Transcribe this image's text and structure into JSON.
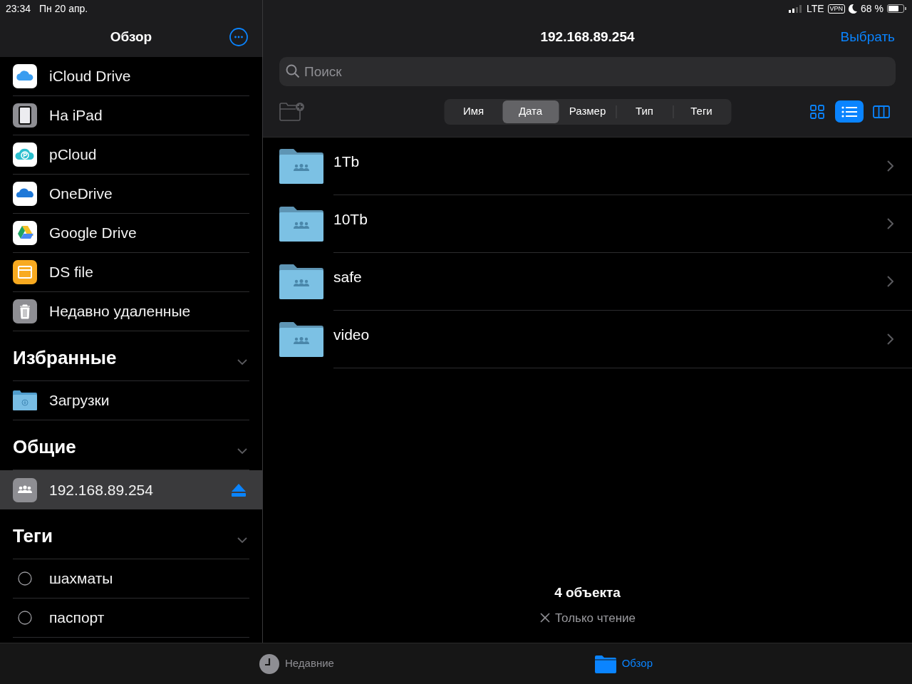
{
  "status_bar": {
    "time": "23:34",
    "date": "Пн 20 апр.",
    "network": "LTE",
    "vpn": "VPN",
    "battery": "68 %"
  },
  "sidebar": {
    "title": "Обзор",
    "locations": [
      {
        "label": "iCloud Drive",
        "kind": "icloud",
        "selected": false
      },
      {
        "label": "На iPad",
        "kind": "ipad",
        "selected": false
      },
      {
        "label": "pCloud",
        "kind": "pcloud",
        "selected": false
      },
      {
        "label": "OneDrive",
        "kind": "onedrive",
        "selected": false
      },
      {
        "label": "Google Drive",
        "kind": "gdrive",
        "selected": false
      },
      {
        "label": "DS file",
        "kind": "dsfile",
        "selected": false
      },
      {
        "label": "Недавно удаленные",
        "kind": "trash",
        "selected": false
      }
    ],
    "sections": [
      {
        "title": "Избранные",
        "expanded": true,
        "items": [
          {
            "label": "Загрузки",
            "kind": "downloads",
            "selected": false
          }
        ]
      },
      {
        "title": "Общие",
        "expanded": true,
        "items": [
          {
            "label": "192.168.89.254",
            "kind": "server",
            "selected": true
          }
        ]
      },
      {
        "title": "Теги",
        "expanded": true,
        "items": [
          {
            "label": "шахматы",
            "kind": "tag",
            "selected": false
          },
          {
            "label": "паспорт",
            "kind": "tag",
            "selected": false
          }
        ]
      }
    ]
  },
  "main": {
    "title": "192.168.89.254",
    "select_button": "Выбрать",
    "search": {
      "placeholder": "Поиск"
    },
    "sort_tabs": [
      {
        "label": "Имя",
        "selected": false
      },
      {
        "label": "Дата",
        "selected": true
      },
      {
        "label": "Размер",
        "selected": false
      },
      {
        "label": "Тип",
        "selected": false
      },
      {
        "label": "Теги",
        "selected": false
      }
    ],
    "view_buttons": [
      {
        "kind": "grid",
        "selected": false
      },
      {
        "kind": "list",
        "selected": true
      },
      {
        "kind": "columns",
        "selected": false
      }
    ],
    "folders": [
      {
        "name": "1Tb"
      },
      {
        "name": "10Tb"
      },
      {
        "name": "safe"
      },
      {
        "name": "video"
      }
    ],
    "count": "4 объекта",
    "access": "Только чтение"
  },
  "tab_bar": [
    {
      "label": "Недавние",
      "kind": "recents",
      "selected": false
    },
    {
      "label": "Обзор",
      "kind": "browse",
      "selected": true
    }
  ]
}
